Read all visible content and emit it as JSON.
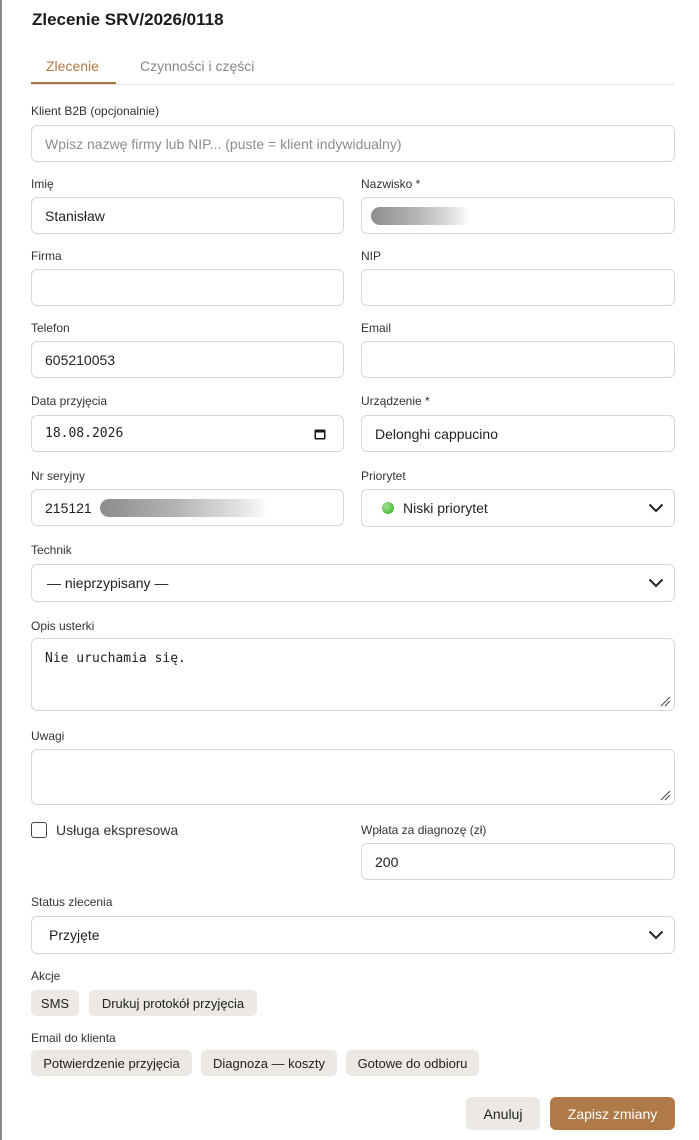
{
  "dialog": {
    "title": "Zlecenie SRV/2026/0118"
  },
  "tabs": [
    {
      "label": "Zlecenie",
      "active": true
    },
    {
      "label": "Czynności i części",
      "active": false
    }
  ],
  "form": {
    "client_b2b": {
      "label": "Klient B2B (opcjonalnie)",
      "placeholder": "Wpisz nazwę firmy lub NIP... (puste = klient indywidualny)",
      "value": ""
    },
    "first_name": {
      "label": "Imię",
      "value": "Stanisław"
    },
    "last_name": {
      "label": "Nazwisko *",
      "value": "",
      "redacted": true
    },
    "company": {
      "label": "Firma",
      "value": ""
    },
    "nip": {
      "label": "NIP",
      "value": ""
    },
    "phone": {
      "label": "Telefon",
      "value": "605210053"
    },
    "email": {
      "label": "Email",
      "value": ""
    },
    "intake_date": {
      "label": "Data przyjęcia",
      "value": "18.08.2026",
      "icon": "calendar-icon"
    },
    "device": {
      "label": "Urządzenie *",
      "value": "Delonghi cappucino"
    },
    "serial": {
      "label": "Nr seryjny",
      "value": "215121",
      "redacted_suffix": true
    },
    "priority": {
      "label": "Priorytet",
      "value": "Niski priorytet",
      "dot_color": "#5cbf4a"
    },
    "technician": {
      "label": "Technik",
      "value": "— nieprzypisany —"
    },
    "fault": {
      "label": "Opis usterki",
      "value": "Nie uruchamia się."
    },
    "notes": {
      "label": "Uwagi",
      "value": ""
    },
    "express": {
      "label": "Usługa ekspresowa",
      "checked": false
    },
    "diagnosis_fee": {
      "label": "Wpłata za diagnozę (zł)",
      "value": "200"
    },
    "status": {
      "label": "Status zlecenia",
      "value": "Przyjęte"
    }
  },
  "actions": {
    "label": "Akcje",
    "buttons": [
      "SMS",
      "Drukuj protokół przyjęcia"
    ]
  },
  "email_to_client": {
    "label": "Email do klienta",
    "buttons": [
      "Potwierdzenie przyjęcia",
      "Diagnoza — koszty",
      "Gotowe do odbioru"
    ]
  },
  "footer": {
    "cancel": "Anuluj",
    "save": "Zapisz zmiany"
  },
  "colors": {
    "accent": "#b07a48",
    "chip_bg": "#ece8e3",
    "border": "#d9d7d3"
  }
}
